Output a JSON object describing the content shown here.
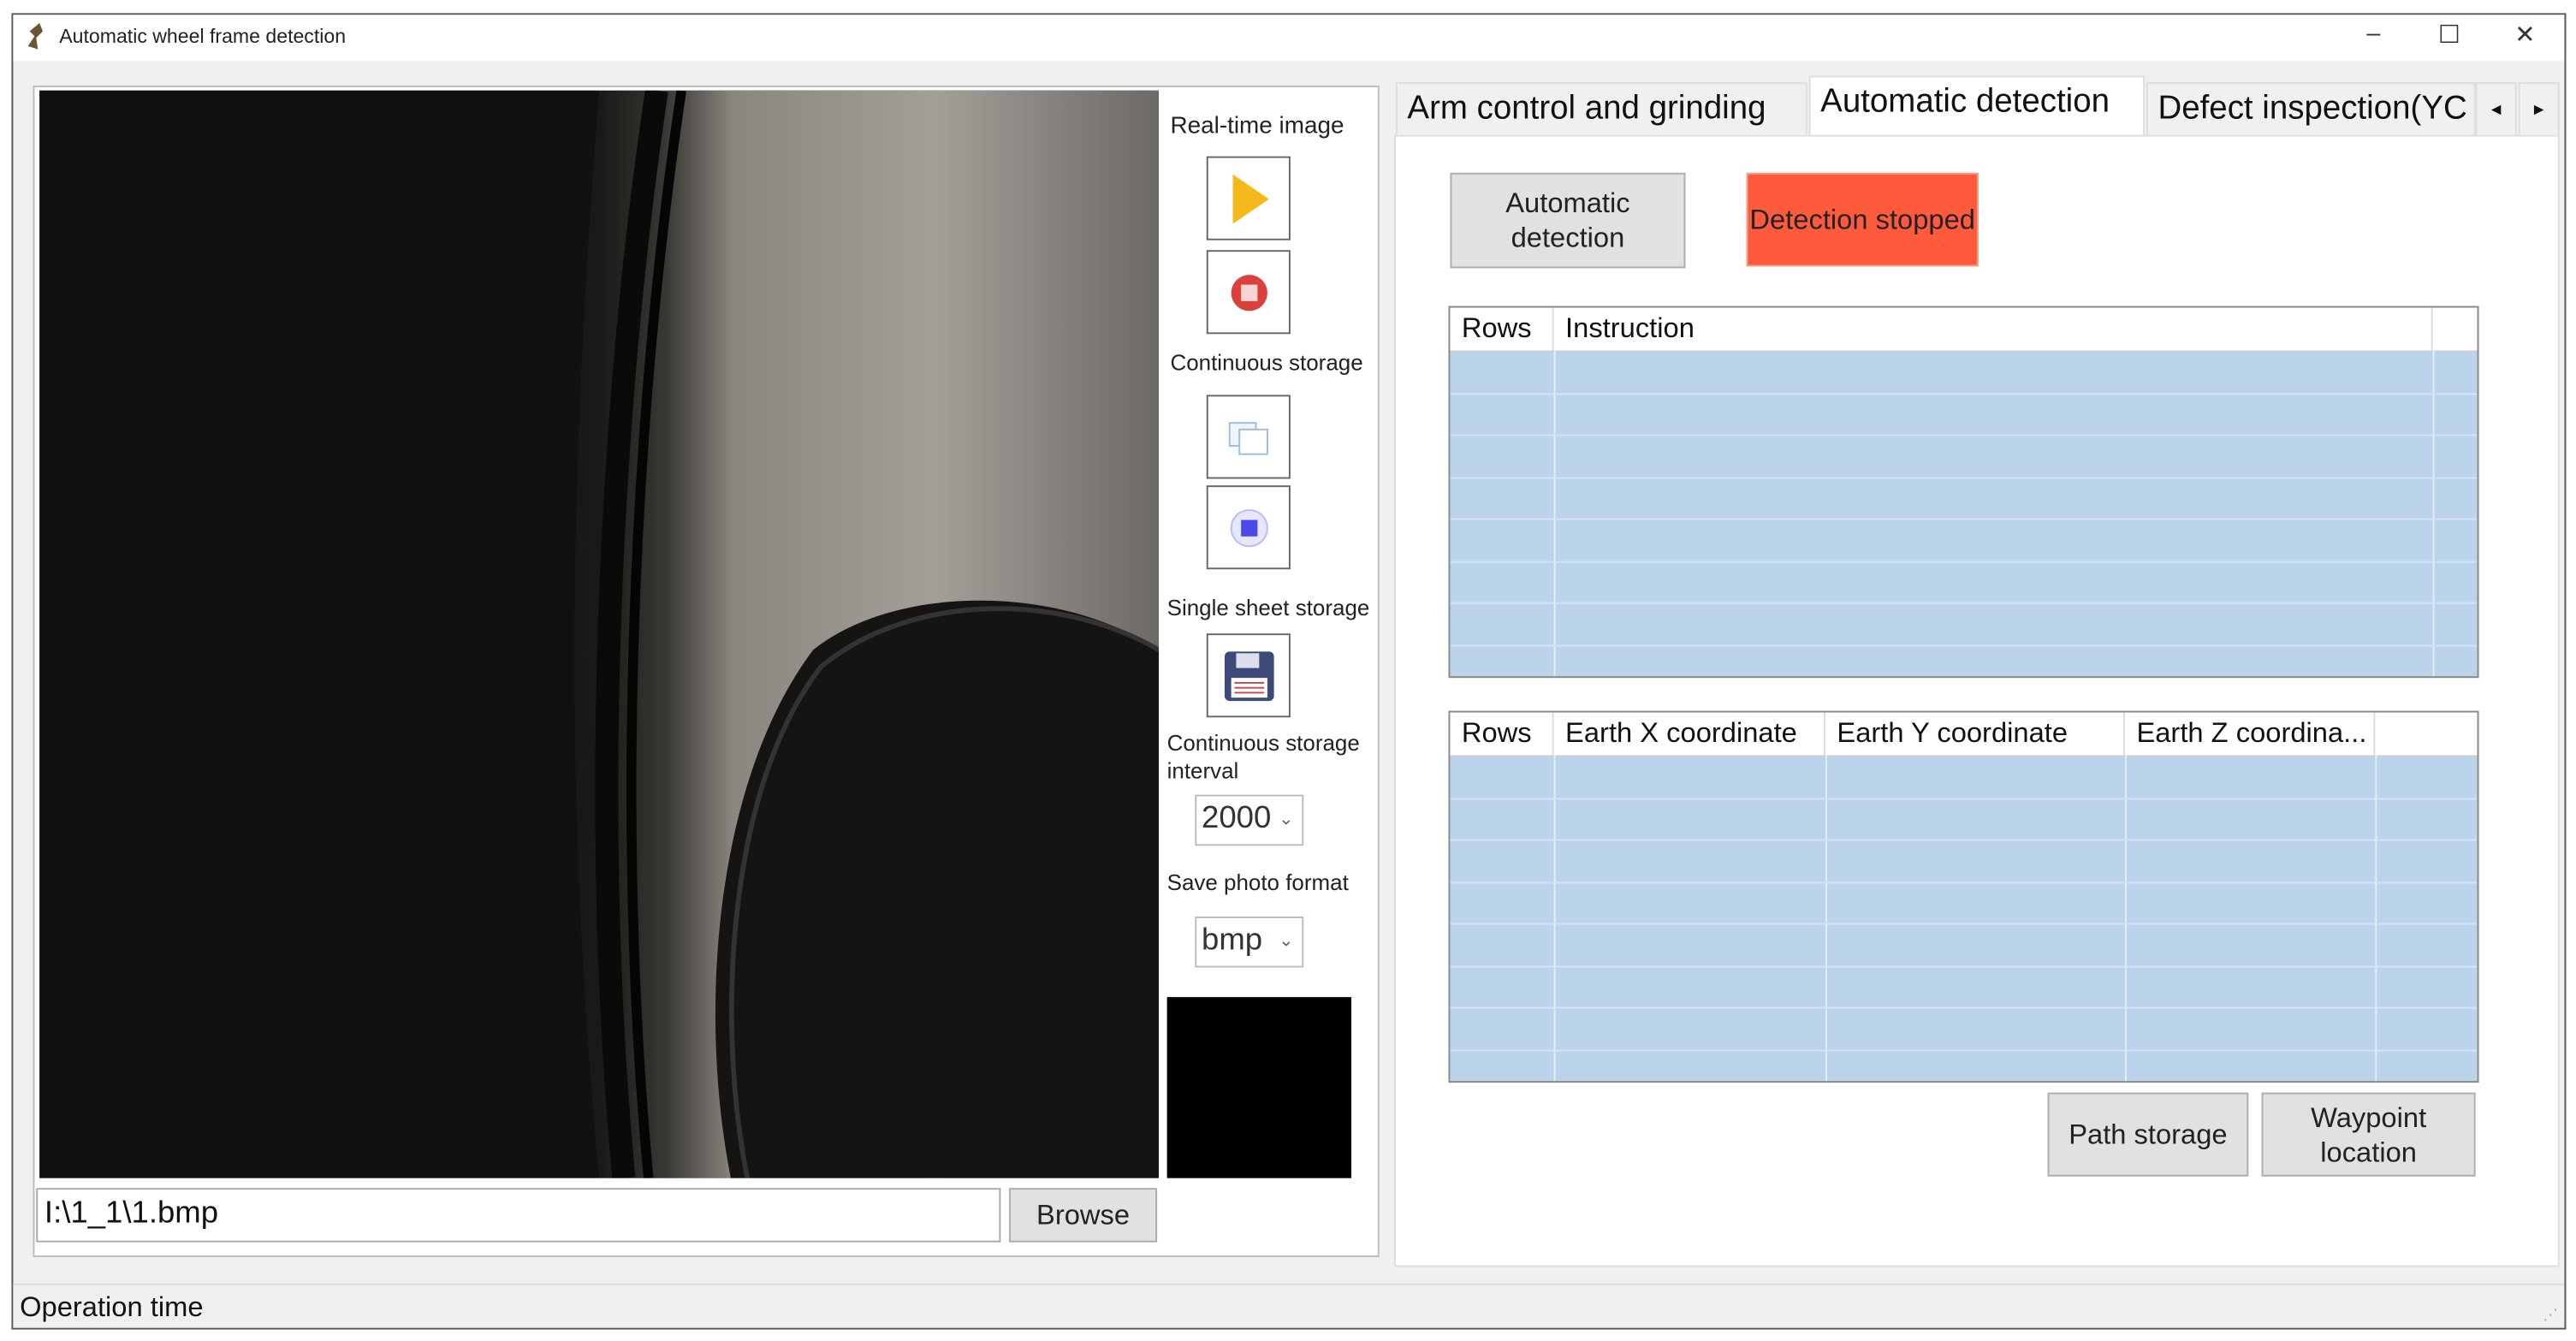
{
  "window": {
    "title": "Automatic wheel frame detection",
    "minimize": "–",
    "maximize": "☐",
    "close": "✕"
  },
  "left": {
    "path_value": "I:\\1_1\\1.bmp",
    "browse_label": "Browse",
    "realtime_label": "Real-time image",
    "continuous_label": "Continuous storage",
    "single_label": "Single sheet storage",
    "interval_label": "Continuous storage interval",
    "interval_value": "2000",
    "format_label": "Save photo format",
    "format_value": "bmp"
  },
  "tabs": [
    {
      "label": "Arm control and grinding",
      "active": false
    },
    {
      "label": "Automatic detection",
      "active": true
    },
    {
      "label": "Defect inspection(YC",
      "active": false
    }
  ],
  "tab_scroll": {
    "left": "◂",
    "right": "▸"
  },
  "detection": {
    "auto_button": "Automatic detection",
    "stopped_button": "Detection stopped",
    "stopped_color": "#ff5a3c",
    "instruction_table": {
      "columns": [
        "Rows",
        "Instruction"
      ],
      "rows": 8
    },
    "coord_table": {
      "columns": [
        "Rows",
        "Earth X coordinate",
        "Earth Y coordinate",
        "Earth Z coordina..."
      ],
      "rows": 8
    },
    "path_storage": "Path storage",
    "waypoint_location": "Waypoint location"
  },
  "status": {
    "label": "Operation time"
  }
}
